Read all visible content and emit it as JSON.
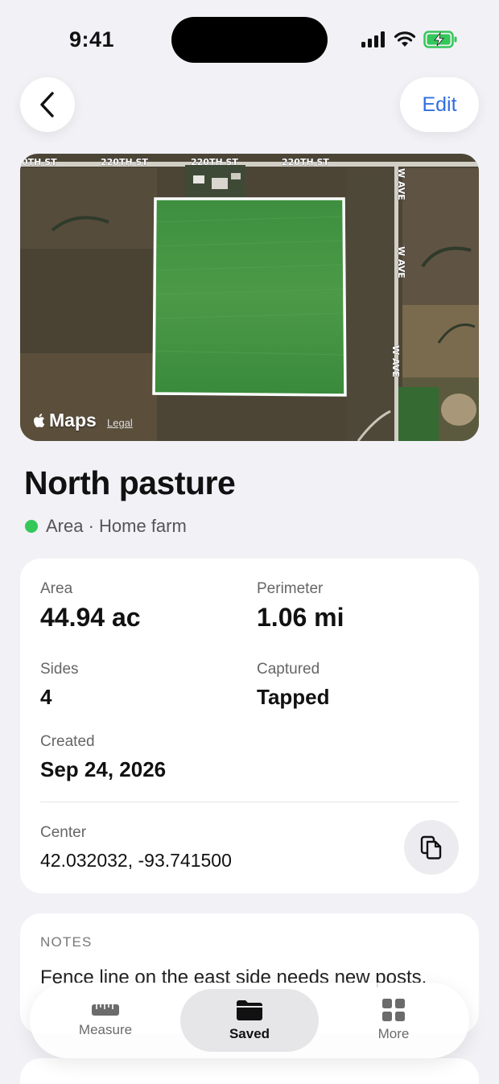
{
  "status_bar": {
    "time": "9:41"
  },
  "nav": {
    "edit_label": "Edit"
  },
  "map": {
    "street_labels": [
      "0TH ST",
      "220TH ST",
      "220TH ST",
      "220TH ST",
      "W AVE",
      "W AVE",
      "W AVE"
    ],
    "brand": "Maps",
    "legal": "Legal"
  },
  "item": {
    "title": "North pasture",
    "subtitle": "Area · Home farm",
    "status_color": "#34c759"
  },
  "stats": {
    "area_label": "Area",
    "area_value": "44.94 ac",
    "perimeter_label": "Perimeter",
    "perimeter_value": "1.06 mi",
    "sides_label": "Sides",
    "sides_value": "4",
    "captured_label": "Captured",
    "captured_value": "Tapped",
    "created_label": "Created",
    "created_value": "Sep 24, 2026",
    "center_label": "Center",
    "center_value": "42.032032, -93.741500"
  },
  "notes": {
    "label": "NOTES",
    "text": "Fence line on the east side needs new posts."
  },
  "tabbar": {
    "tabs": [
      {
        "label": "Measure",
        "icon": "ruler-icon"
      },
      {
        "label": "Saved",
        "icon": "folder-icon"
      },
      {
        "label": "More",
        "icon": "grid-icon"
      }
    ]
  },
  "colors": {
    "accent": "#2f6fe0",
    "field": "#3c8c40"
  }
}
